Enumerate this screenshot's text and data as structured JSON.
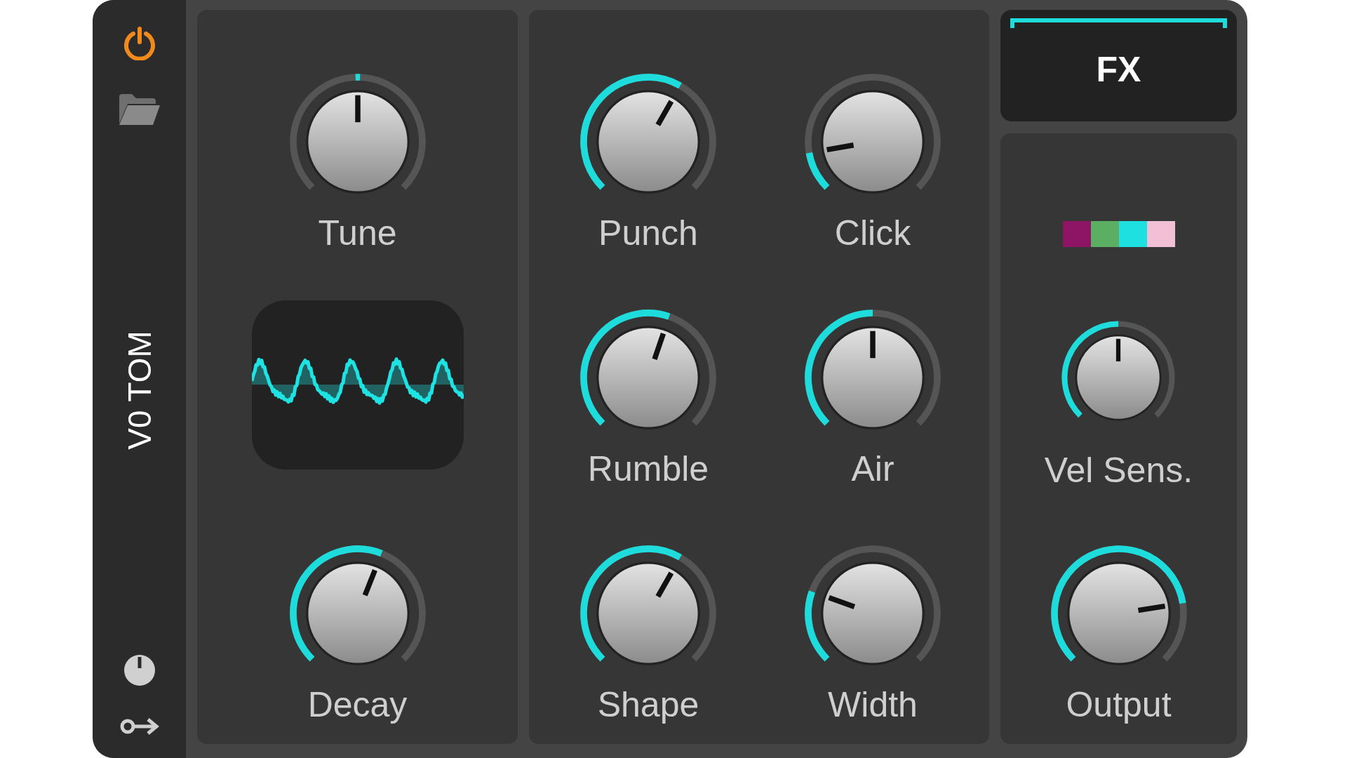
{
  "sidebar": {
    "power": {
      "on": true
    },
    "title": "V0 TOM"
  },
  "panels": [
    {
      "items": [
        {
          "kind": "knob",
          "label": "Tune"
        },
        {
          "kind": "scope"
        },
        {
          "kind": "knob",
          "label": "Decay"
        }
      ]
    },
    {
      "items": [
        {
          "kind": "knob",
          "label": "Punch"
        },
        {
          "kind": "knob",
          "label": "Click"
        },
        {
          "kind": "knob",
          "label": "Rumble"
        },
        {
          "kind": "knob",
          "label": "Air"
        },
        {
          "kind": "knob",
          "label": "Shape"
        },
        {
          "kind": "knob",
          "label": "Width"
        }
      ]
    }
  ],
  "fx": {
    "label": "FX",
    "on": true
  },
  "swatches": [
    {
      "color": "#8e1566"
    },
    {
      "color": "#5aaf62"
    },
    {
      "color": "#1fe0e0"
    },
    {
      "color": "#f2c0d4"
    }
  ],
  "output_knobs": [
    {
      "kind": "miniknob",
      "label": "Vel Sens."
    },
    {
      "kind": "knob",
      "label": "Output"
    }
  ]
}
